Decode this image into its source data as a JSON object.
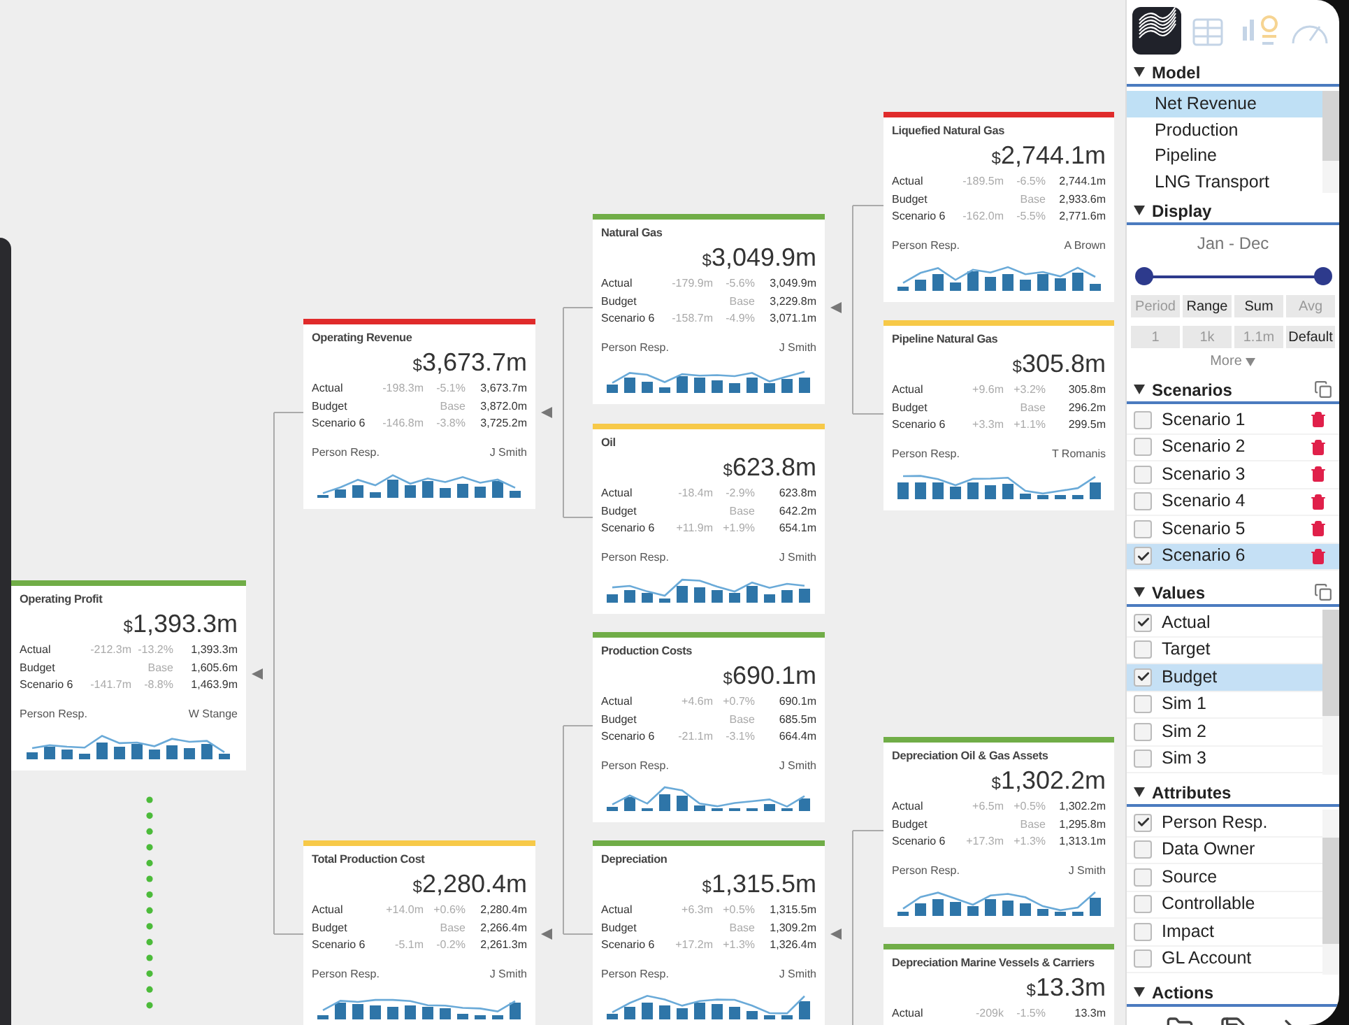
{
  "tree": {
    "title": "Operating Profit",
    "color": "#70ad47",
    "currency": "$",
    "total": "1,393.3m",
    "attribute": "Person Resp.",
    "person": "W Stange",
    "rows": [
      {
        "label": "Actual",
        "delta": "-212.3m",
        "pct": "-13.2%",
        "value": "1,393.3m"
      },
      {
        "label": "Budget",
        "pct": "Base",
        "value": "1,605.6m"
      },
      {
        "label": "Scenario 6",
        "delta": "-141.7m",
        "pct": "-8.8%",
        "value": "1,463.9m"
      }
    ],
    "children": [
      {
        "title": "Operating Revenue",
        "color": "#e02b2b",
        "currency": "$",
        "total": "3,673.7m",
        "attribute": "Person Resp.",
        "person": "J Smith",
        "rows": [
          {
            "label": "Actual",
            "delta": "-198.3m",
            "pct": "-5.1%",
            "value": "3,673.7m"
          },
          {
            "label": "Budget",
            "pct": "Base",
            "value": "3,872.0m"
          },
          {
            "label": "Scenario 6",
            "delta": "-146.8m",
            "pct": "-3.8%",
            "value": "3,725.2m"
          }
        ],
        "children": [
          {
            "title": "Natural Gas",
            "color": "#70ad47",
            "currency": "$",
            "total": "3,049.9m",
            "attribute": "Person Resp.",
            "person": "J Smith",
            "rows": [
              {
                "label": "Actual",
                "delta": "-179.9m",
                "pct": "-5.6%",
                "value": "3,049.9m"
              },
              {
                "label": "Budget",
                "pct": "Base",
                "value": "3,229.8m"
              },
              {
                "label": "Scenario 6",
                "delta": "-158.7m",
                "pct": "-4.9%",
                "value": "3,071.1m"
              }
            ],
            "children": [
              {
                "title": "Liquefied Natural Gas",
                "color": "#e02b2b",
                "currency": "$",
                "total": "2,744.1m",
                "attribute": "Person Resp.",
                "person": "A Brown",
                "rows": [
                  {
                    "label": "Actual",
                    "delta": "-189.5m",
                    "pct": "-6.5%",
                    "value": "2,744.1m"
                  },
                  {
                    "label": "Budget",
                    "pct": "Base",
                    "value": "2,933.6m"
                  },
                  {
                    "label": "Scenario 6",
                    "delta": "-162.0m",
                    "pct": "-5.5%",
                    "value": "2,771.6m"
                  }
                ]
              },
              {
                "title": "Pipeline Natural Gas",
                "color": "#f7c948",
                "currency": "$",
                "total": "305.8m",
                "attribute": "Person Resp.",
                "person": "T Romanis",
                "rows": [
                  {
                    "label": "Actual",
                    "delta": "+9.6m",
                    "pct": "+3.2%",
                    "value": "305.8m"
                  },
                  {
                    "label": "Budget",
                    "pct": "Base",
                    "value": "296.2m"
                  },
                  {
                    "label": "Scenario 6",
                    "delta": "+3.3m",
                    "pct": "+1.1%",
                    "value": "299.5m"
                  }
                ]
              }
            ]
          },
          {
            "title": "Oil",
            "color": "#f7c948",
            "currency": "$",
            "total": "623.8m",
            "attribute": "Person Resp.",
            "person": "J Smith",
            "rows": [
              {
                "label": "Actual",
                "delta": "-18.4m",
                "pct": "-2.9%",
                "value": "623.8m"
              },
              {
                "label": "Budget",
                "pct": "Base",
                "value": "642.2m"
              },
              {
                "label": "Scenario 6",
                "delta": "+11.9m",
                "pct": "+1.9%",
                "value": "654.1m"
              }
            ]
          }
        ]
      },
      {
        "title": "Total Production Cost",
        "color": "#f7c948",
        "currency": "$",
        "total": "2,280.4m",
        "attribute": "Person Resp.",
        "person": "J Smith",
        "rows": [
          {
            "label": "Actual",
            "delta": "+14.0m",
            "pct": "+0.6%",
            "value": "2,280.4m"
          },
          {
            "label": "Budget",
            "pct": "Base",
            "value": "2,266.4m"
          },
          {
            "label": "Scenario 6",
            "delta": "-5.1m",
            "pct": "-0.2%",
            "value": "2,261.3m"
          }
        ],
        "children": [
          {
            "title": "Production Costs",
            "color": "#70ad47",
            "currency": "$",
            "total": "690.1m",
            "attribute": "Person Resp.",
            "person": "J Smith",
            "rows": [
              {
                "label": "Actual",
                "delta": "+4.6m",
                "pct": "+0.7%",
                "value": "690.1m"
              },
              {
                "label": "Budget",
                "pct": "Base",
                "value": "685.5m"
              },
              {
                "label": "Scenario 6",
                "delta": "-21.1m",
                "pct": "-3.1%",
                "value": "664.4m"
              }
            ]
          },
          {
            "title": "Depreciation",
            "color": "#70ad47",
            "currency": "$",
            "total": "1,315.5m",
            "attribute": "Person Resp.",
            "person": "J Smith",
            "rows": [
              {
                "label": "Actual",
                "delta": "+6.3m",
                "pct": "+0.5%",
                "value": "1,315.5m"
              },
              {
                "label": "Budget",
                "pct": "Base",
                "value": "1,309.2m"
              },
              {
                "label": "Scenario 6",
                "delta": "+17.2m",
                "pct": "+1.3%",
                "value": "1,326.4m"
              }
            ],
            "children": [
              {
                "title": "Depreciation Oil & Gas Assets",
                "color": "#70ad47",
                "currency": "$",
                "total": "1,302.2m",
                "attribute": "Person Resp.",
                "person": "J Smith",
                "rows": [
                  {
                    "label": "Actual",
                    "delta": "+6.5m",
                    "pct": "+0.5%",
                    "value": "1,302.2m"
                  },
                  {
                    "label": "Budget",
                    "pct": "Base",
                    "value": "1,295.8m"
                  },
                  {
                    "label": "Scenario 6",
                    "delta": "+17.3m",
                    "pct": "+1.3%",
                    "value": "1,313.1m"
                  }
                ]
              },
              {
                "title": "Depreciation Marine Vessels & Carriers",
                "color": "#70ad47",
                "currency": "$",
                "total": "13.3m",
                "rows": [
                  {
                    "label": "Actual",
                    "delta": "-209k",
                    "pct": "-1.5%",
                    "value": "13.3m"
                  }
                ]
              }
            ]
          }
        ]
      }
    ]
  },
  "sidebar": {
    "view_icons": [
      {
        "kind": "waves",
        "selected": true
      },
      {
        "kind": "table",
        "selected": false
      },
      {
        "kind": "charts",
        "selected": false
      },
      {
        "kind": "gauge",
        "selected": false
      }
    ],
    "sections": [
      {
        "kind": "list",
        "title": "Model",
        "expanded": true,
        "items": [
          {
            "label": "Net Revenue",
            "selected": true
          },
          {
            "label": "Production",
            "selected": false
          },
          {
            "label": "Pipeline",
            "selected": false
          },
          {
            "label": "LNG Transport",
            "selected": false
          }
        ]
      },
      {
        "kind": "display",
        "title": "Display",
        "expanded": true,
        "period": "Jan - Dec",
        "range": [
          {
            "level": 0
          },
          {
            "level": 1
          }
        ],
        "more": "More",
        "buttons": [
          [
            {
              "label": "Period",
              "selected": false
            },
            {
              "label": "Range",
              "selected": true
            },
            {
              "label": "Sum",
              "selected": true
            },
            {
              "label": "Avg",
              "selected": false
            }
          ],
          [
            {
              "label": "1",
              "selected": false
            },
            {
              "label": "1k",
              "selected": false
            },
            {
              "label": "1.1m",
              "selected": false
            },
            {
              "label": "Default",
              "selected": true
            }
          ]
        ]
      },
      {
        "kind": "scenarios",
        "title": "Scenarios",
        "expanded": true,
        "copyable": true,
        "items": [
          {
            "label": "Scenario 1",
            "checked": false,
            "selected": false
          },
          {
            "label": "Scenario 2",
            "checked": false,
            "selected": false
          },
          {
            "label": "Scenario 3",
            "checked": false,
            "selected": false
          },
          {
            "label": "Scenario 4",
            "checked": false,
            "selected": false
          },
          {
            "label": "Scenario 5",
            "checked": false,
            "selected": false
          },
          {
            "label": "Scenario 6",
            "checked": true,
            "selected": true
          }
        ]
      },
      {
        "kind": "checklist",
        "title": "Values",
        "expanded": true,
        "copyable": true,
        "items": [
          {
            "label": "Actual",
            "checked": true,
            "selected": false
          },
          {
            "label": "Target",
            "checked": false,
            "selected": false
          },
          {
            "label": "Budget",
            "checked": true,
            "selected": true
          },
          {
            "label": "Sim 1",
            "checked": false,
            "selected": false
          },
          {
            "label": "Sim 2",
            "checked": false,
            "selected": false
          },
          {
            "label": "Sim 3",
            "checked": false,
            "selected": false
          }
        ]
      },
      {
        "kind": "checklist",
        "title": "Attributes",
        "expanded": true,
        "copyable": false,
        "items": [
          {
            "label": "Person Resp.",
            "checked": true,
            "selected": false
          },
          {
            "label": "Data Owner",
            "checked": false,
            "selected": false
          },
          {
            "label": "Source",
            "checked": false,
            "selected": false
          },
          {
            "label": "Controllable",
            "checked": false,
            "selected": false
          },
          {
            "label": "Impact",
            "checked": false,
            "selected": false
          },
          {
            "label": "GL Account",
            "checked": false,
            "selected": false
          }
        ]
      },
      {
        "kind": "actions",
        "title": "Actions",
        "expanded": true,
        "actions": [
          {
            "kind": "folder"
          },
          {
            "kind": "save"
          },
          {
            "kind": "arrow"
          }
        ]
      }
    ]
  }
}
